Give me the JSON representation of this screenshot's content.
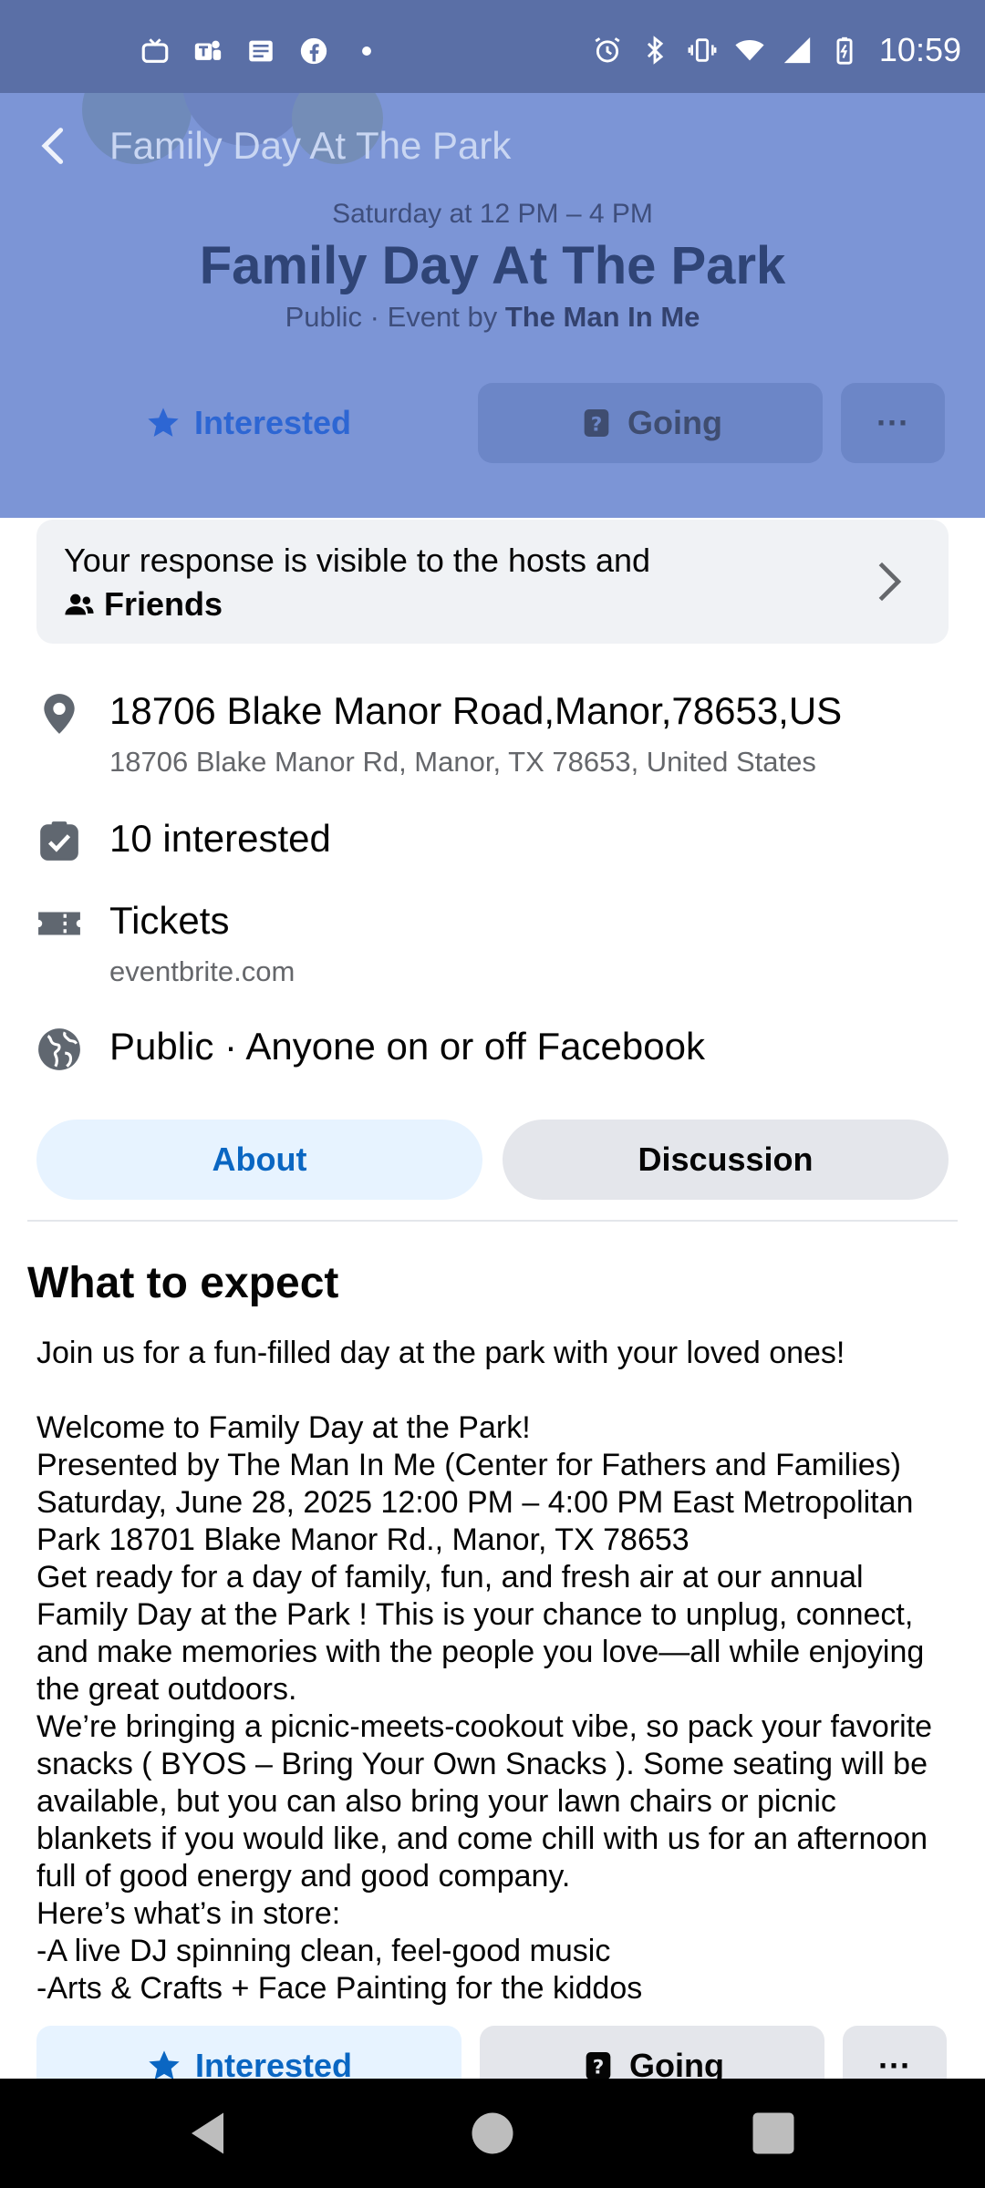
{
  "status_bar": {
    "time": "10:59",
    "left_icons": [
      "tv-icon",
      "teams-icon",
      "news-icon",
      "facebook-icon",
      "dot-icon"
    ],
    "right_icons": [
      "alarm-icon",
      "bluetooth-icon",
      "vibrate-icon",
      "wifi-icon",
      "signal-icon",
      "battery-icon"
    ]
  },
  "header": {
    "app_title": "Family Day At The Park",
    "when": "Saturday at 12 PM – 4 PM",
    "title": "Family Day At The Park",
    "meta_prefix": "Public · Event by ",
    "meta_host": "The Man In Me"
  },
  "actions": {
    "interested": "Interested",
    "going": "Going",
    "more": "···"
  },
  "response_card": {
    "line1": "Your response is visible to the hosts and",
    "line2": "Friends"
  },
  "details": {
    "address_main": "18706 Blake Manor Road,Manor,78653,US",
    "address_sub": "18706 Blake Manor Rd, Manor, TX 78653, United States",
    "interested": "10 interested",
    "tickets": "Tickets",
    "tickets_site": "eventbrite.com",
    "privacy": "Public · Anyone on or off Facebook"
  },
  "tabs": {
    "about": "About",
    "discussion": "Discussion"
  },
  "about": {
    "section_title": "What to expect",
    "intro": "Join us for a fun-filled day at the park with your loved ones!",
    "lines": [
      "Welcome to Family Day at the Park!",
      "Presented by The Man In Me (Center for Fathers and Families)",
      "Saturday, June 28, 2025 12:00 PM – 4:00 PM East Metropolitan Park 18701 Blake Manor Rd., Manor, TX 78653",
      "Get ready for a day of family, fun, and fresh air at our annual Family Day at the Park ! This is your chance to unplug, connect, and make memories with the people you love—all while enjoying the great outdoors.",
      "We’re bringing a picnic-meets-cookout vibe, so pack your favorite snacks ( BYOS – Bring Your Own Snacks ). Some seating will be available, but you can also bring your lawn chairs or picnic blankets if you would like, and come chill with us for an afternoon full of good energy and good company.",
      "Here’s what’s in store:",
      "-A live DJ spinning clean, feel-good music",
      "-Arts & Crafts + Face Painting for the kiddos"
    ]
  },
  "colors": {
    "accent": "#0a66c2",
    "header_overlay": "#7c95d6",
    "status_bar": "#5a6fa6"
  }
}
